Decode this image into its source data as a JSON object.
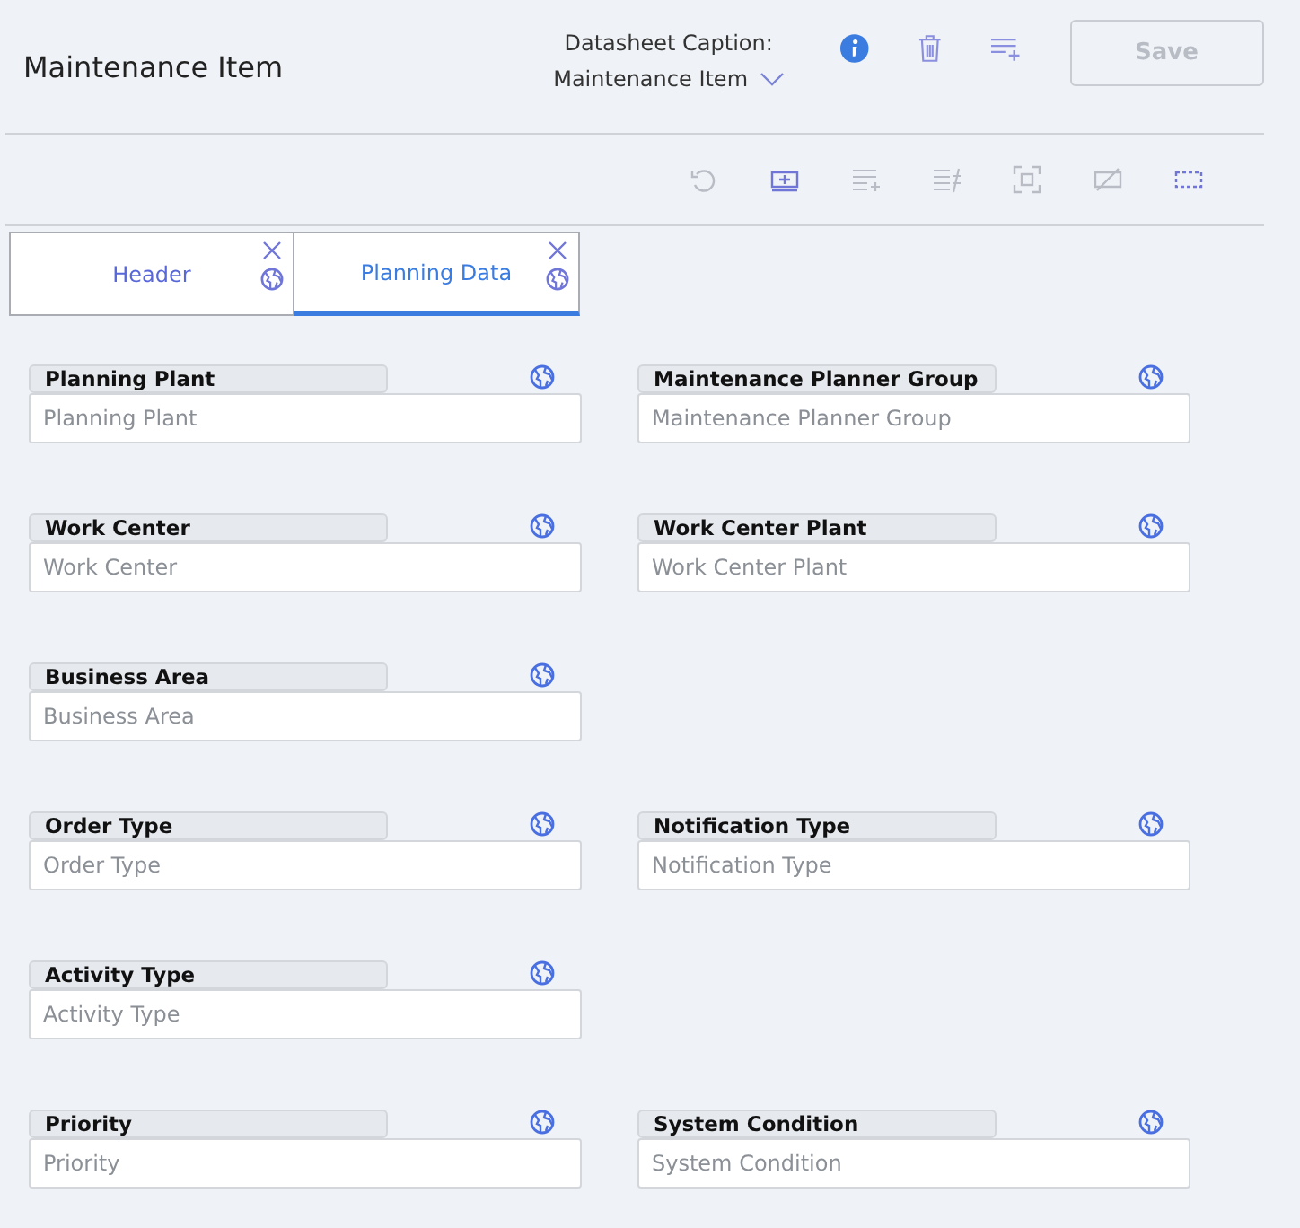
{
  "title": "Maintenance Item",
  "caption": {
    "label": "Datasheet Caption:",
    "value": "Maintenance Item"
  },
  "save": {
    "label": "Save",
    "disabled": true
  },
  "toolbar": [
    {
      "kind": "undo",
      "disabled": true
    },
    {
      "kind": "add-box",
      "disabled": false
    },
    {
      "kind": "list-add",
      "disabled": true
    },
    {
      "kind": "list-strike",
      "disabled": true
    },
    {
      "kind": "focus",
      "disabled": true
    },
    {
      "kind": "slash",
      "disabled": true
    },
    {
      "kind": "dashed",
      "disabled": false
    }
  ],
  "tabs": [
    {
      "label": "Header",
      "selected": false
    },
    {
      "label": "Planning Data",
      "selected": true
    }
  ],
  "rows": [
    {
      "fields": [
        {
          "label": "Planning Plant",
          "placeholder": "Planning Plant"
        },
        {
          "label": "Maintenance Planner Group",
          "placeholder": "Maintenance Planner Group"
        }
      ]
    },
    {
      "fields": [
        {
          "label": "Work Center",
          "placeholder": "Work Center"
        },
        {
          "label": "Work Center Plant",
          "placeholder": "Work Center Plant"
        }
      ]
    },
    {
      "fields": [
        {
          "label": "Business Area",
          "placeholder": "Business Area"
        }
      ]
    },
    {
      "fields": [
        {
          "label": "Order Type",
          "placeholder": "Order Type"
        },
        {
          "label": "Notification Type",
          "placeholder": "Notification Type"
        }
      ]
    },
    {
      "fields": [
        {
          "label": "Activity Type",
          "placeholder": "Activity Type"
        }
      ]
    },
    {
      "fields": [
        {
          "label": "Priority",
          "placeholder": "Priority"
        },
        {
          "label": "System Condition",
          "placeholder": "System Condition"
        }
      ]
    }
  ]
}
